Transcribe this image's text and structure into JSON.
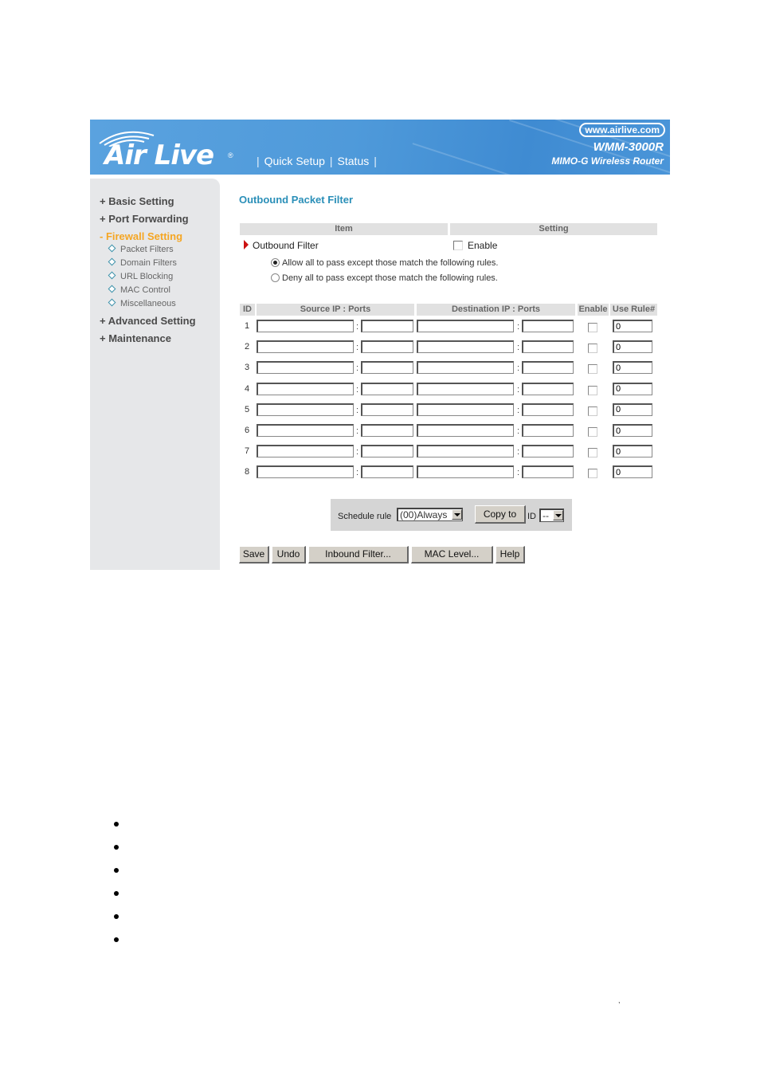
{
  "header": {
    "brand": "Air Live",
    "brand_mark": "®",
    "nav": [
      {
        "label": "Quick Setup"
      },
      {
        "label": "Status"
      }
    ],
    "site_url": "www.airlive.com",
    "model": "WMM-3000R",
    "model_subtitle": "MIMO-G Wireless Router"
  },
  "sidebar": {
    "items": [
      {
        "label": "+ Basic Setting"
      },
      {
        "label": "+ Port Forwarding"
      },
      {
        "label": "- Firewall Setting",
        "active": true
      },
      {
        "label": "+ Advanced Setting"
      },
      {
        "label": "+ Maintenance"
      }
    ],
    "sub_items": [
      {
        "label": "Packet Filters"
      },
      {
        "label": "Domain Filters"
      },
      {
        "label": "URL Blocking"
      },
      {
        "label": "MAC Control"
      },
      {
        "label": "Miscellaneous"
      }
    ]
  },
  "main": {
    "title": "Outbound Packet Filter",
    "settings_headers": {
      "item": "Item",
      "setting": "Setting"
    },
    "outbound_filter": {
      "label": "Outbound Filter",
      "enable_label": "Enable",
      "enabled": false
    },
    "policy_options": [
      {
        "label": "Allow all to pass except those match the following rules.",
        "selected": true
      },
      {
        "label": "Deny all to pass except those match the following rules.",
        "selected": false
      }
    ],
    "rules_table": {
      "headers": {
        "id": "ID",
        "source": "Source IP : Ports",
        "destination": "Destination IP : Ports",
        "enable": "Enable",
        "use_rule": "Use Rule#"
      },
      "separator": ":",
      "rows": [
        {
          "id": "1",
          "src_ip": "",
          "src_port": "",
          "dst_ip": "",
          "dst_port": "",
          "enabled": false,
          "use_rule": "0"
        },
        {
          "id": "2",
          "src_ip": "",
          "src_port": "",
          "dst_ip": "",
          "dst_port": "",
          "enabled": false,
          "use_rule": "0"
        },
        {
          "id": "3",
          "src_ip": "",
          "src_port": "",
          "dst_ip": "",
          "dst_port": "",
          "enabled": false,
          "use_rule": "0"
        },
        {
          "id": "4",
          "src_ip": "",
          "src_port": "",
          "dst_ip": "",
          "dst_port": "",
          "enabled": false,
          "use_rule": "0"
        },
        {
          "id": "5",
          "src_ip": "",
          "src_port": "",
          "dst_ip": "",
          "dst_port": "",
          "enabled": false,
          "use_rule": "0"
        },
        {
          "id": "6",
          "src_ip": "",
          "src_port": "",
          "dst_ip": "",
          "dst_port": "",
          "enabled": false,
          "use_rule": "0"
        },
        {
          "id": "7",
          "src_ip": "",
          "src_port": "",
          "dst_ip": "",
          "dst_port": "",
          "enabled": false,
          "use_rule": "0"
        },
        {
          "id": "8",
          "src_ip": "",
          "src_port": "",
          "dst_ip": "",
          "dst_port": "",
          "enabled": false,
          "use_rule": "0"
        }
      ]
    },
    "schedule": {
      "label": "Schedule rule",
      "selected": "(00)Always",
      "copy_button": "Copy to",
      "id_label": "ID",
      "id_selected": "--"
    },
    "buttons": {
      "save": "Save",
      "undo": "Undo",
      "inbound": "Inbound Filter...",
      "mac": "MAC Level...",
      "help": "Help"
    }
  },
  "document": {
    "bullet_count": 6,
    "stray_mark": ","
  }
}
